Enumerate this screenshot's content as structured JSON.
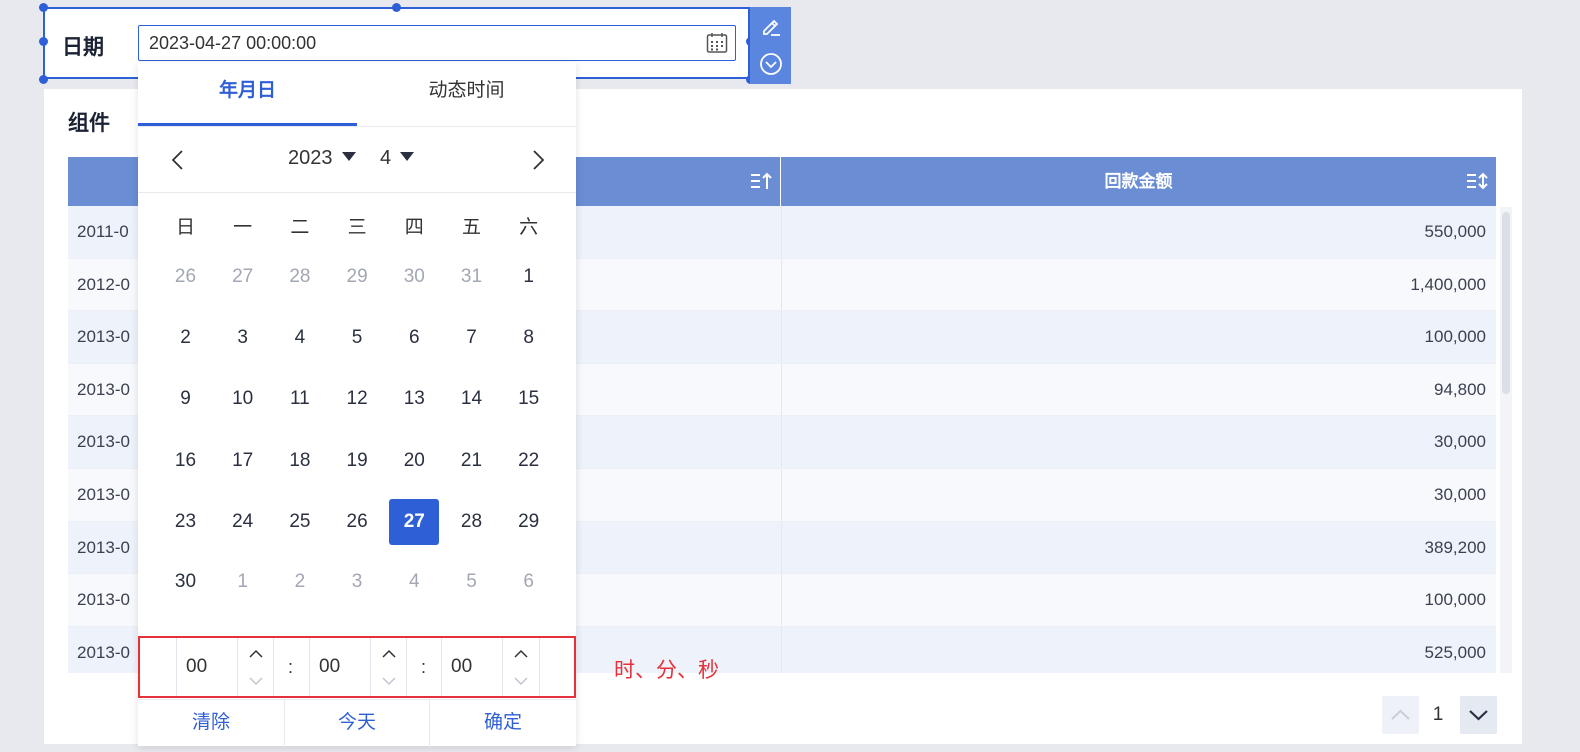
{
  "panel": {
    "title": "组件",
    "columns": [
      "",
      "回款金额"
    ],
    "rows": [
      [
        "2011-0",
        "550,000"
      ],
      [
        "2012-0",
        "1,400,000"
      ],
      [
        "2013-0",
        "100,000"
      ],
      [
        "2013-0",
        "94,800"
      ],
      [
        "2013-0",
        "30,000"
      ],
      [
        "2013-0",
        "30,000"
      ],
      [
        "2013-0",
        "389,200"
      ],
      [
        "2013-0",
        "100,000"
      ],
      [
        "2013-0",
        "525,000"
      ]
    ],
    "page_number": "1"
  },
  "widget": {
    "label": "日期",
    "value": "2023-04-27 00:00:00"
  },
  "popup": {
    "tabs": [
      "年月日",
      "动态时间"
    ],
    "active_tab": 0,
    "year": "2023",
    "month": "4",
    "weekdays": [
      "日",
      "一",
      "二",
      "三",
      "四",
      "五",
      "六"
    ],
    "days": [
      [
        "26",
        "27",
        "28",
        "29",
        "30",
        "31",
        "1"
      ],
      [
        "2",
        "3",
        "4",
        "5",
        "6",
        "7",
        "8"
      ],
      [
        "9",
        "10",
        "11",
        "12",
        "13",
        "14",
        "15"
      ],
      [
        "16",
        "17",
        "18",
        "19",
        "20",
        "21",
        "22"
      ],
      [
        "23",
        "24",
        "25",
        "26",
        "27",
        "28",
        "29"
      ],
      [
        "30",
        "1",
        "2",
        "3",
        "4",
        "5",
        "6"
      ]
    ],
    "muted": [
      [
        true,
        true,
        true,
        true,
        true,
        true,
        false
      ],
      [
        false,
        false,
        false,
        false,
        false,
        false,
        false
      ],
      [
        false,
        false,
        false,
        false,
        false,
        false,
        false
      ],
      [
        false,
        false,
        false,
        false,
        false,
        false,
        false
      ],
      [
        false,
        false,
        false,
        false,
        false,
        false,
        false
      ],
      [
        false,
        true,
        true,
        true,
        true,
        true,
        true
      ]
    ],
    "selected_day": "27",
    "time": {
      "hour": "00",
      "minute": "00",
      "second": "00",
      "separator": ":"
    },
    "buttons": {
      "clear": "清除",
      "today": "今天",
      "confirm": "确定"
    }
  },
  "annotation": "时、分、秒",
  "colors": {
    "accent": "#2f5fd6",
    "header": "#6a8dd4",
    "highlight": "#e5323a"
  },
  "icons": [
    "calendar-icon",
    "edit-icon",
    "dropdown-circle-icon",
    "sort-asc-icon",
    "sort-both-icon",
    "chevron-left-icon",
    "chevron-right-icon",
    "chevron-up-icon",
    "chevron-down-icon"
  ]
}
